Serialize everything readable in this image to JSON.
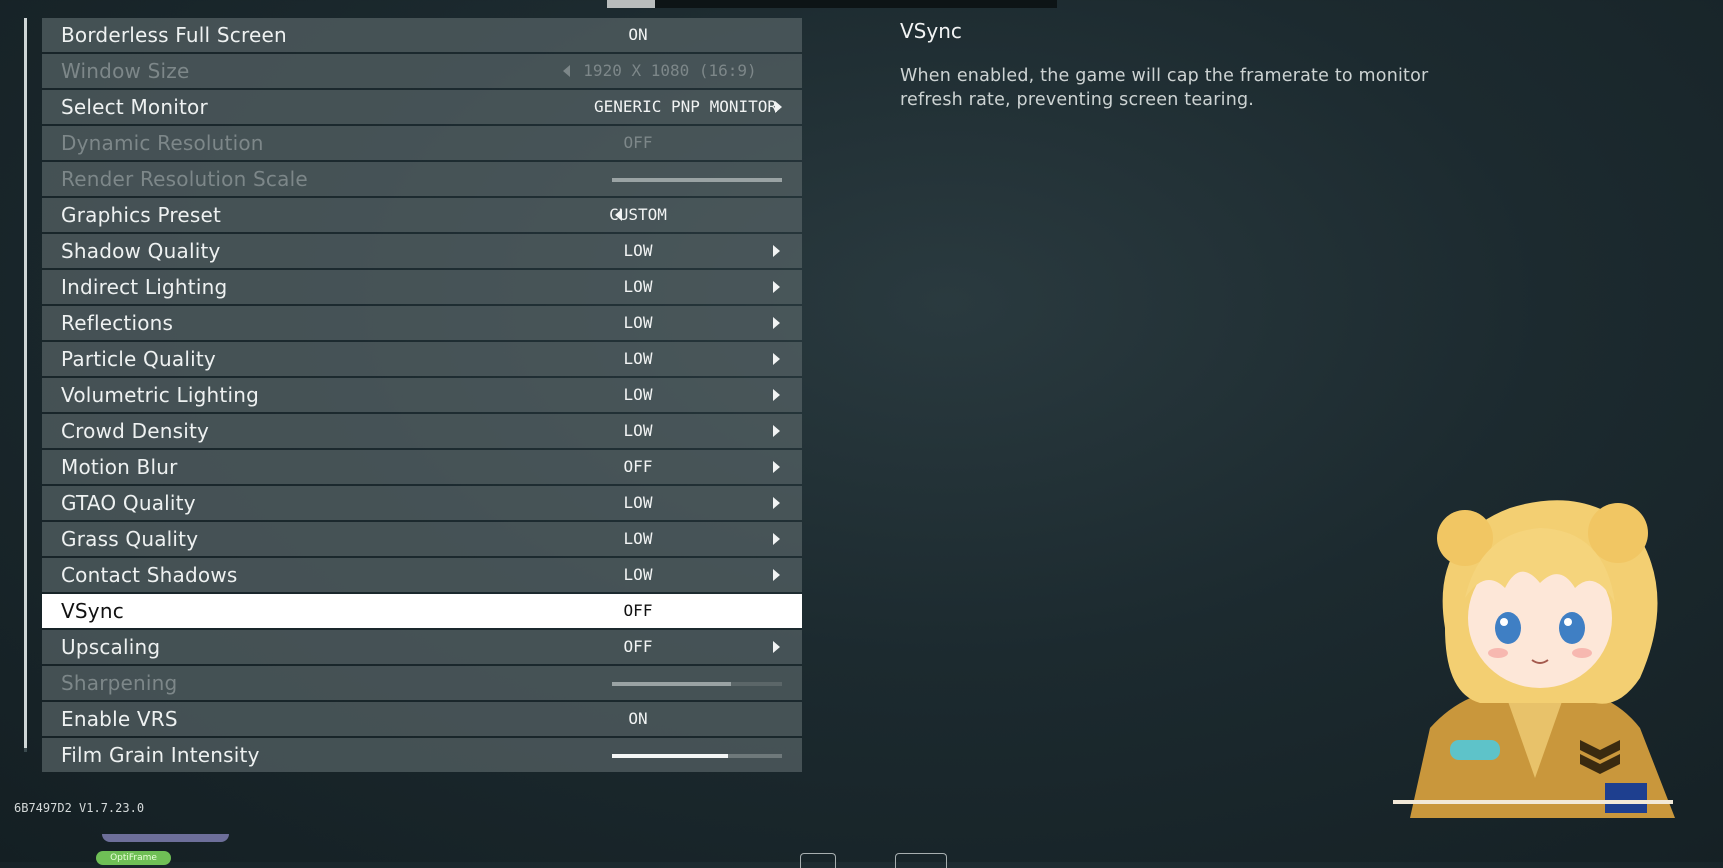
{
  "settings": [
    {
      "label": "Borderless Full Screen",
      "value": "ON",
      "state": "normal",
      "arrow_right": false
    },
    {
      "label": "Window Size",
      "value": "1920 X 1080 (16:9)",
      "state": "disabled",
      "arrow_left": true
    },
    {
      "label": "Select Monitor",
      "value": "GENERIC PNP MONITOR",
      "state": "normal",
      "arrow_right": true
    },
    {
      "label": "Dynamic Resolution",
      "value": "OFF",
      "state": "disabled"
    },
    {
      "label": "Render Resolution Scale",
      "slider_fraction": 1.0,
      "state": "disabled"
    },
    {
      "label": "Graphics Preset",
      "value": "CUSTOM",
      "state": "normal",
      "arrow_left": true
    },
    {
      "label": "Shadow Quality",
      "value": "LOW",
      "state": "normal",
      "arrow_right": true
    },
    {
      "label": "Indirect Lighting",
      "value": "LOW",
      "state": "normal",
      "arrow_right": true
    },
    {
      "label": "Reflections",
      "value": "LOW",
      "state": "normal",
      "arrow_right": true
    },
    {
      "label": "Particle Quality",
      "value": "LOW",
      "state": "normal",
      "arrow_right": true
    },
    {
      "label": "Volumetric Lighting",
      "value": "LOW",
      "state": "normal",
      "arrow_right": true
    },
    {
      "label": "Crowd Density",
      "value": "LOW",
      "state": "normal",
      "arrow_right": true
    },
    {
      "label": "Motion Blur",
      "value": "OFF",
      "state": "normal",
      "arrow_right": true
    },
    {
      "label": "GTAO Quality",
      "value": "LOW",
      "state": "normal",
      "arrow_right": true
    },
    {
      "label": "Grass Quality",
      "value": "LOW",
      "state": "normal",
      "arrow_right": true
    },
    {
      "label": "Contact Shadows",
      "value": "LOW",
      "state": "normal",
      "arrow_right": true
    },
    {
      "label": "VSync",
      "value": "OFF",
      "state": "selected"
    },
    {
      "label": "Upscaling",
      "value": "OFF",
      "state": "normal",
      "arrow_right": true
    },
    {
      "label": "Sharpening",
      "slider_fraction": 0.7,
      "state": "disabled"
    },
    {
      "label": "Enable VRS",
      "value": "ON",
      "state": "normal"
    },
    {
      "label": "Film Grain Intensity",
      "slider_fraction": 0.68,
      "state": "normal"
    }
  ],
  "description": {
    "title": "VSync",
    "body": "When enabled, the game will cap the framerate to monitor refresh rate, preventing screen tearing."
  },
  "footer": {
    "version": "6B7497D2 V1.7.23.0",
    "badge": "OptiFrame"
  },
  "icons": {
    "arrow_right": "triangle-right-icon",
    "arrow_left": "triangle-left-icon"
  },
  "colors": {
    "row_bg": "#566265",
    "selected_bg": "#ffffff",
    "disabled_text": "#7d8789",
    "background": "#1c2a2f"
  }
}
